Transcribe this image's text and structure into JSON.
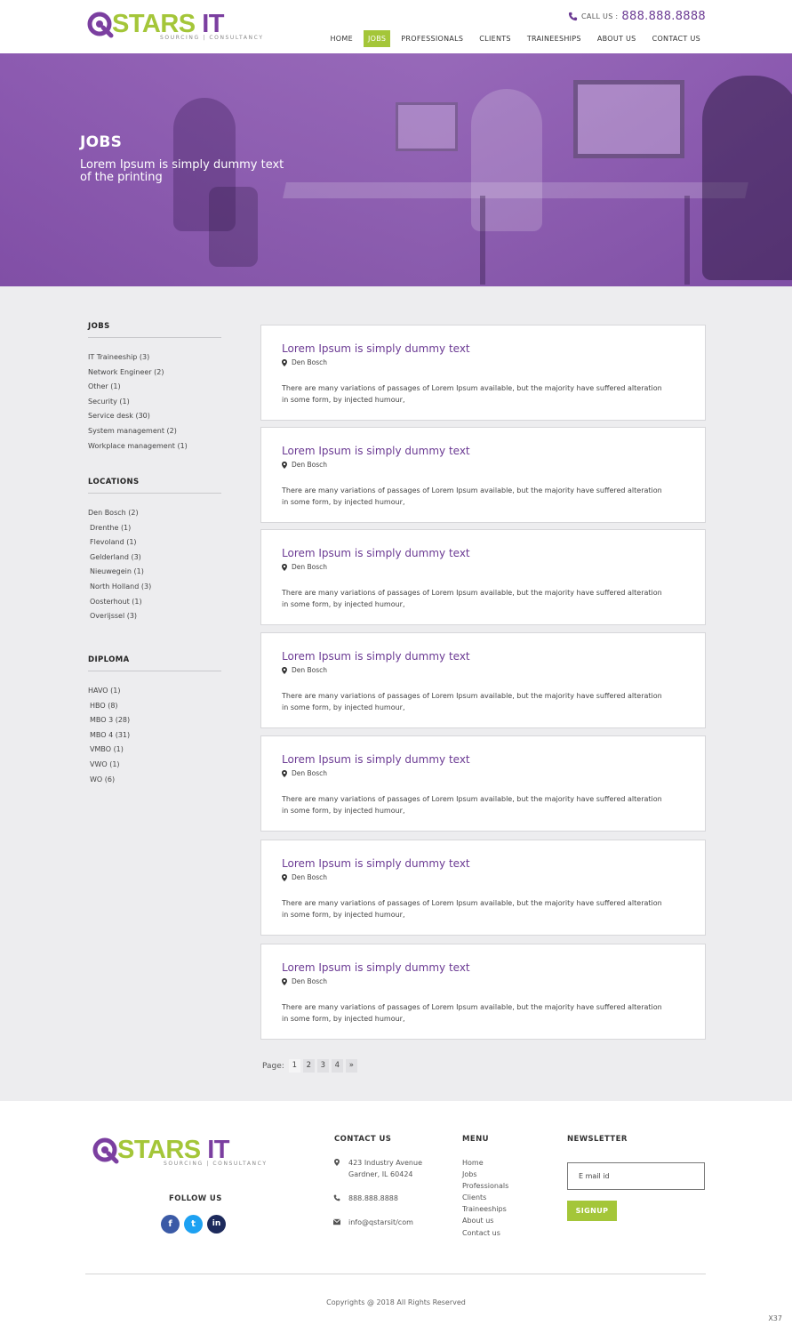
{
  "brand": {
    "logo_q": "Q",
    "logo_stars": "STARS",
    "logo_it": " IT",
    "tagline": "SOURCING | CONSULTANCY",
    "colors": {
      "purple": "#7b3fa0",
      "green": "#a4c639"
    }
  },
  "header": {
    "call_label": "CALL US :",
    "phone": "888.888.8888",
    "nav": [
      {
        "label": "HOME",
        "active": false
      },
      {
        "label": "JOBS",
        "active": true
      },
      {
        "label": "PROFESSIONALS",
        "active": false
      },
      {
        "label": "CLIENTS",
        "active": false
      },
      {
        "label": "TRAINEESHIPS",
        "active": false
      },
      {
        "label": "ABOUT US",
        "active": false
      },
      {
        "label": "CONTACT US",
        "active": false
      }
    ]
  },
  "hero": {
    "title": "JOBS",
    "subtitle": "Lorem Ipsum is simply dummy text of the printing"
  },
  "sidebar": {
    "jobs": {
      "title": "JOBS",
      "items": [
        "IT Traineeship (3)",
        "Network Engineer (2)",
        "Other (1)",
        "Security (1)",
        "Service desk (30)",
        "System management (2)",
        "Workplace management (1)"
      ]
    },
    "locations": {
      "title": "LOCATIONS",
      "items": [
        "Den Bosch (2)",
        "Drenthe (1)",
        "Flevoland (1)",
        "Gelderland (3)",
        "Nieuwegein (1)",
        "North Holland (3)",
        "Oosterhout (1)",
        "Overijssel (3)"
      ]
    },
    "diploma": {
      "title": "DIPLOMA",
      "items": [
        "HAVO (1)",
        "HBO (8)",
        "MBO 3 (28)",
        "MBO 4 (31)",
        "VMBO (1)",
        "VWO (1)",
        "WO (6)"
      ]
    }
  },
  "jobs": [
    {
      "title": "Lorem Ipsum is simply dummy text",
      "location": "Den Bosch",
      "description": "There are many variations of passages of Lorem Ipsum available, but the majority have suffered alteration in some form, by injected humour,"
    },
    {
      "title": "Lorem Ipsum is simply dummy text",
      "location": "Den Bosch",
      "description": "There are many variations of passages of Lorem Ipsum available, but the majority have suffered alteration in some form, by injected humour,"
    },
    {
      "title": "Lorem Ipsum is simply dummy text",
      "location": "Den Bosch",
      "description": "There are many variations of passages of Lorem Ipsum available, but the majority have suffered alteration in some form, by injected humour,"
    },
    {
      "title": "Lorem Ipsum is simply dummy text",
      "location": "Den Bosch",
      "description": "There are many variations of passages of Lorem Ipsum available, but the majority have suffered alteration in some form, by injected humour,"
    },
    {
      "title": "Lorem Ipsum is simply dummy text",
      "location": "Den Bosch",
      "description": "There are many variations of passages of Lorem Ipsum available, but the majority have suffered alteration in some form, by injected humour,"
    },
    {
      "title": "Lorem Ipsum is simply dummy text",
      "location": "Den Bosch",
      "description": "There are many variations of passages of Lorem Ipsum available, but the majority have suffered alteration in some form, by injected humour,"
    },
    {
      "title": "Lorem Ipsum is simply dummy text",
      "location": "Den Bosch",
      "description": "There are many variations of passages of Lorem Ipsum available, but the majority have suffered alteration in some form, by injected humour,"
    }
  ],
  "pagination": {
    "label": "Page:",
    "pages": [
      "1",
      "2",
      "3",
      "4"
    ],
    "current": "1",
    "next": "»"
  },
  "footer": {
    "follow_title": "FOLLOW US",
    "socials": [
      {
        "name": "facebook-icon",
        "glyph": "f"
      },
      {
        "name": "twitter-icon",
        "glyph": "t"
      },
      {
        "name": "linkedin-icon",
        "glyph": "in"
      }
    ],
    "contact": {
      "title": "CONTACT US",
      "address_line1": "423 Industry Avenue",
      "address_line2": "Gardner, IL 60424",
      "phone": "888.888.8888",
      "email": "info@qstarsit/com"
    },
    "menu": {
      "title": "MENU",
      "items": [
        "Home",
        "Jobs",
        "Professionals",
        "Clients",
        "Traineeships",
        "About us",
        "Contact us"
      ]
    },
    "newsletter": {
      "title": "NEWSLETTER",
      "placeholder": "E mail id",
      "button": "SIGNUP"
    },
    "copyright": "Copyrights @ 2018 All Rights Reserved",
    "corner_label": "X37"
  }
}
